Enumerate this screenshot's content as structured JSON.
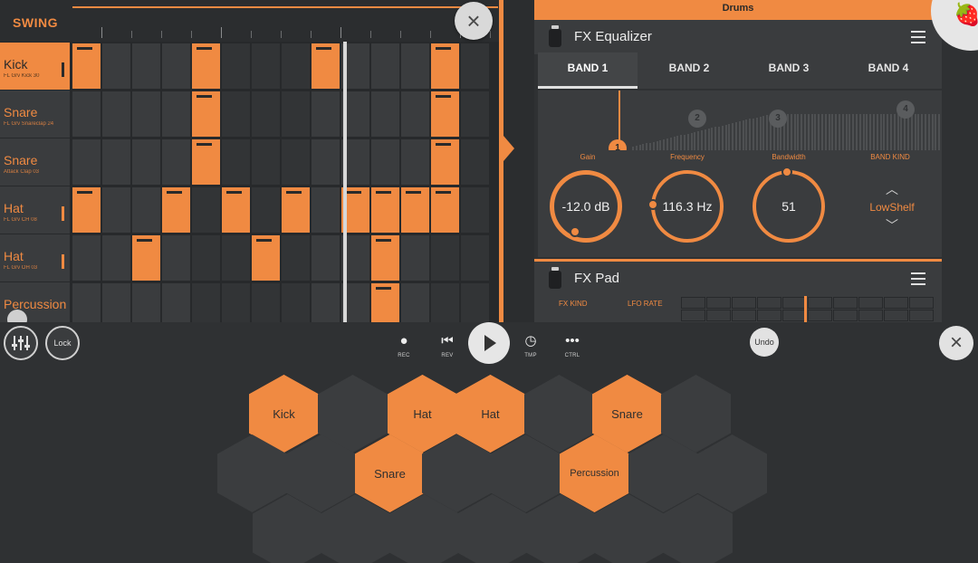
{
  "sequencer": {
    "swing_label": "SWING",
    "channels": [
      {
        "name": "Kick",
        "sample": "FL Grv Kick 30",
        "selected": true,
        "steps": [
          1,
          0,
          0,
          0,
          1,
          0,
          0,
          0,
          1,
          0,
          0,
          0,
          1,
          0
        ]
      },
      {
        "name": "Snare",
        "sample": "FL Grv Snareclap 24",
        "selected": false,
        "steps": [
          0,
          0,
          0,
          0,
          1,
          0,
          0,
          0,
          0,
          0,
          0,
          0,
          1,
          0
        ]
      },
      {
        "name": "Snare",
        "sample": "Attack Clap 03",
        "selected": false,
        "steps": [
          0,
          0,
          0,
          0,
          1,
          0,
          0,
          0,
          0,
          0,
          0,
          0,
          1,
          0
        ]
      },
      {
        "name": "Hat",
        "sample": "FL Grv CH 08",
        "selected": false,
        "steps": [
          1,
          0,
          0,
          1,
          0,
          1,
          0,
          1,
          0,
          1,
          1,
          1,
          1,
          0
        ]
      },
      {
        "name": "Hat",
        "sample": "FL Grv OH 03",
        "selected": false,
        "steps": [
          0,
          0,
          1,
          0,
          0,
          0,
          1,
          0,
          0,
          0,
          1,
          0,
          0,
          0
        ]
      },
      {
        "name": "Percussion",
        "sample": "",
        "selected": false,
        "steps": [
          0,
          0,
          0,
          0,
          0,
          0,
          0,
          0,
          0,
          0,
          1,
          0,
          0,
          0
        ]
      }
    ]
  },
  "fx": {
    "pattern_title": "Drums",
    "equalizer": {
      "title": "FX Equalizer",
      "tabs": [
        "BAND 1",
        "BAND 2",
        "BAND 3",
        "BAND 4"
      ],
      "active_tab": 0,
      "band_nodes": [
        "1",
        "2",
        "3",
        "4"
      ],
      "params": {
        "gain_label": "Gain",
        "gain_value": "-12.0 dB",
        "frequency_label": "Frequency",
        "frequency_value": "116.3 Hz",
        "bandwidth_label": "Bandwidth",
        "bandwidth_value": "51",
        "band_kind_label": "BAND KIND",
        "band_kind_value": "LowShelf"
      }
    },
    "pad": {
      "title": "FX Pad",
      "fx_kind_label": "FX KIND",
      "lfo_rate_label": "LFO RATE"
    }
  },
  "transport": {
    "lock_label": "Lock",
    "rec_label": "REC",
    "rev_label": "REV",
    "tmp_label": "TMP",
    "ctrl_label": "CTRL",
    "undo_label": "Undo"
  },
  "icons": {
    "close": "close-icon",
    "mixer": "mixer-icon",
    "menu": "hamburger-menu-icon",
    "play": "play-icon"
  },
  "colors": {
    "accent": "#f08a42",
    "background": "#2f3133",
    "pad_off": "#3b3d3f"
  },
  "hex_pads": [
    {
      "label": "Kick",
      "lit": true
    },
    {
      "label": "",
      "lit": false
    },
    {
      "label": "Hat",
      "lit": true
    },
    {
      "label": "Hat",
      "lit": true
    },
    {
      "label": "",
      "lit": false
    },
    {
      "label": "Snare",
      "lit": true
    },
    {
      "label": "",
      "lit": false
    },
    {
      "label": "",
      "lit": false
    },
    {
      "label": "",
      "lit": false
    },
    {
      "label": "Snare",
      "lit": true
    },
    {
      "label": "",
      "lit": false
    },
    {
      "label": "",
      "lit": false
    },
    {
      "label": "Percussion",
      "lit": true
    },
    {
      "label": "",
      "lit": false
    },
    {
      "label": "",
      "lit": false
    },
    {
      "label": "",
      "lit": false
    },
    {
      "label": "",
      "lit": false
    },
    {
      "label": "",
      "lit": false
    },
    {
      "label": "",
      "lit": false
    },
    {
      "label": "",
      "lit": false
    },
    {
      "label": "",
      "lit": false
    },
    {
      "label": "",
      "lit": false
    }
  ]
}
